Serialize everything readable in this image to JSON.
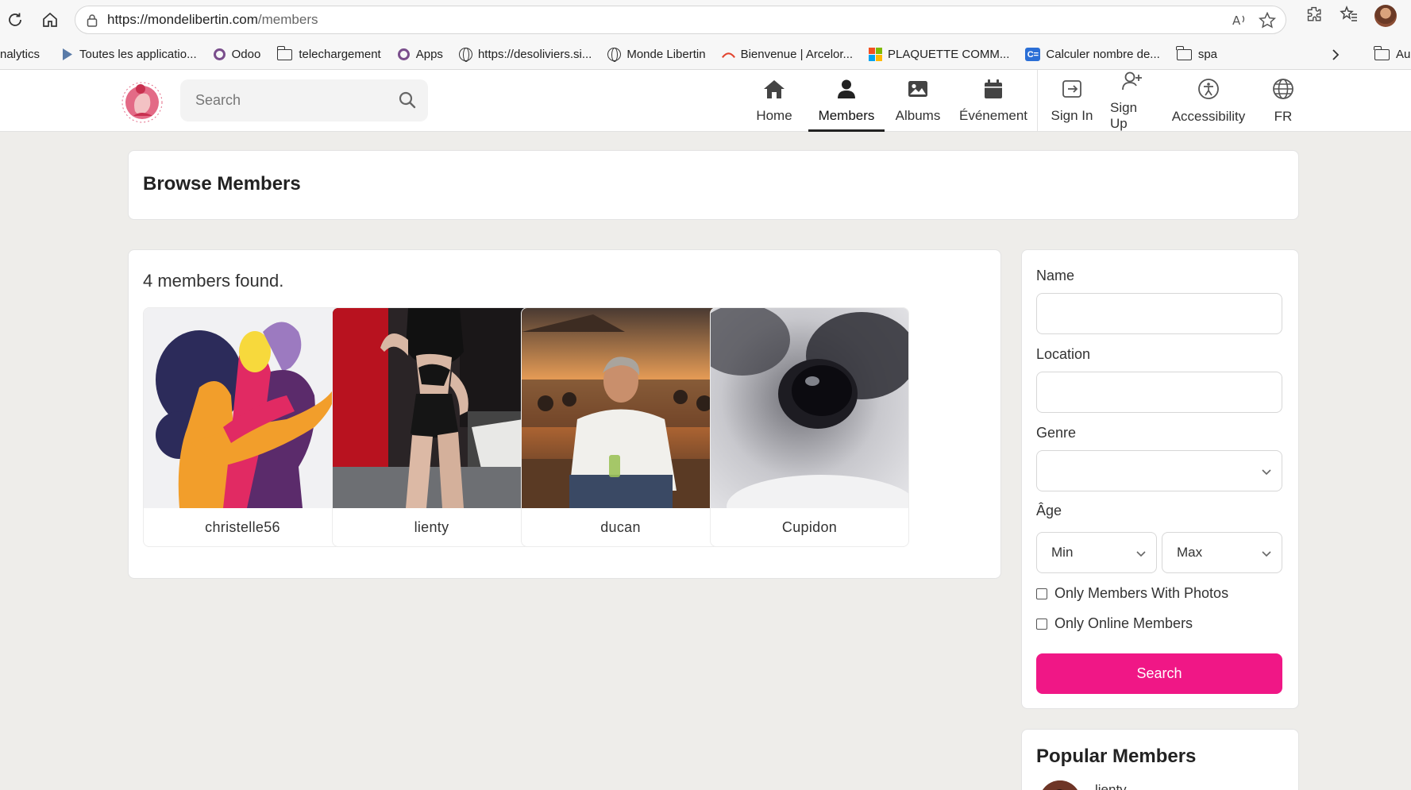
{
  "browser": {
    "url_host": "https://mondelibertin.com",
    "url_path": "/members",
    "bookmarks": [
      {
        "label": "nalytics",
        "icon": "none"
      },
      {
        "label": "Toutes les applicatio...",
        "icon": "play-store-icon"
      },
      {
        "label": "Odoo",
        "icon": "odoo-icon"
      },
      {
        "label": "telechargement",
        "icon": "folder-icon"
      },
      {
        "label": "Apps",
        "icon": "odoo-icon"
      },
      {
        "label": "https://desoliviers.si...",
        "icon": "globe-icon"
      },
      {
        "label": "Monde Libertin",
        "icon": "globe-icon"
      },
      {
        "label": "Bienvenue | Arcelor...",
        "icon": "arcelor-icon"
      },
      {
        "label": "PLAQUETTE COMM...",
        "icon": "microsoft-icon"
      },
      {
        "label": "Calculer nombre de...",
        "icon": "calc-icon"
      },
      {
        "label": "spa",
        "icon": "folder-icon"
      }
    ],
    "overflow_bookmark": "Au"
  },
  "header": {
    "search_placeholder": "Search",
    "nav": [
      {
        "label": "Home",
        "icon": "home-icon",
        "active": false
      },
      {
        "label": "Members",
        "icon": "user-icon",
        "active": true
      },
      {
        "label": "Albums",
        "icon": "image-icon",
        "active": false
      },
      {
        "label": "Événement",
        "icon": "calendar-icon",
        "active": false
      }
    ],
    "account_nav": [
      {
        "label": "Sign In",
        "icon": "sign-in-icon"
      },
      {
        "label": "Sign Up",
        "icon": "user-plus-icon"
      },
      {
        "label": "Accessibility",
        "icon": "accessibility-icon"
      },
      {
        "label": "FR",
        "icon": "globe-icon"
      }
    ]
  },
  "page": {
    "title": "Browse Members",
    "found_text": "4 members found.",
    "members": [
      {
        "name": "christelle56",
        "photo": "illustration"
      },
      {
        "name": "lienty",
        "photo": "photo"
      },
      {
        "name": "ducan",
        "photo": "photo"
      },
      {
        "name": "Cupidon",
        "photo": "photo"
      }
    ]
  },
  "filters": {
    "name_label": "Name",
    "name_value": "",
    "location_label": "Location",
    "location_value": "",
    "genre_label": "Genre",
    "genre_value": "",
    "age_label": "Âge",
    "age_min": "Min",
    "age_max": "Max",
    "only_photos_label": "Only Members With Photos",
    "only_online_label": "Only Online Members",
    "search_button": "Search"
  },
  "popular": {
    "title": "Popular Members",
    "first_member": "lienty"
  },
  "colors": {
    "accent": "#f01786",
    "page_bg": "#eeedea"
  }
}
